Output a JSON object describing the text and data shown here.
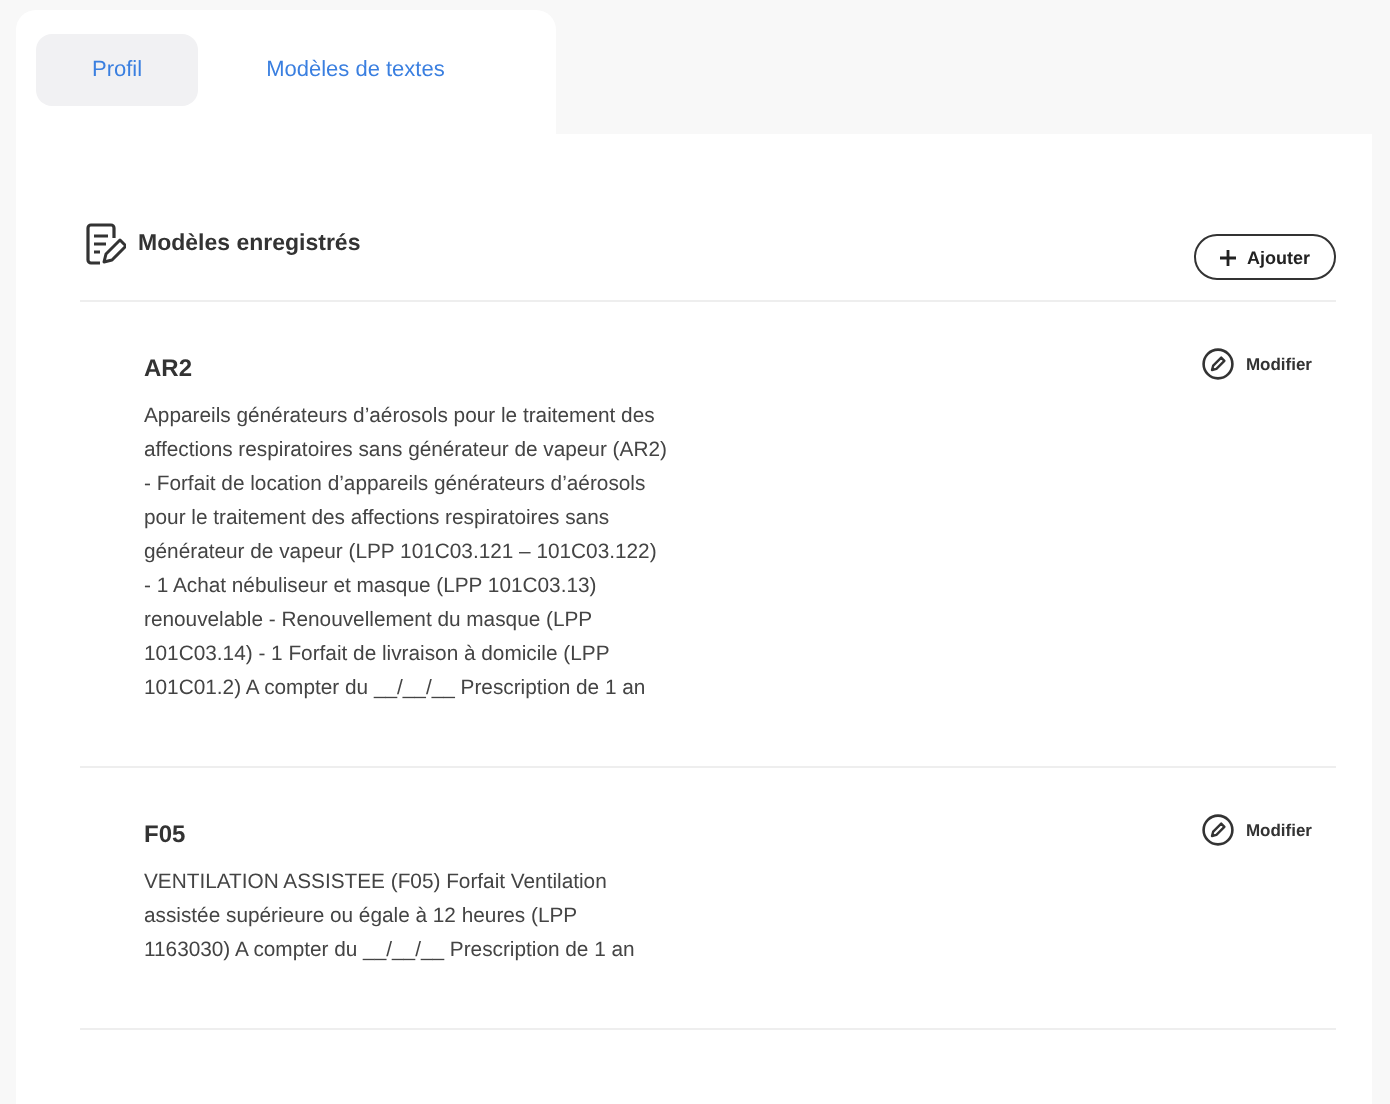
{
  "tabs": [
    {
      "label": "Profil",
      "selected": true
    },
    {
      "label": "Modèles de textes",
      "selected": false
    }
  ],
  "section": {
    "title": "Modèles enregistrés",
    "add_button": "Ajouter"
  },
  "templates": [
    {
      "code": "AR2",
      "text": "Appareils générateurs d’aérosols pour le traitement des affections respiratoires sans générateur de vapeur (AR2) - Forfait de location d’appareils générateurs d’aérosols pour le traitement des affections respiratoires sans générateur de vapeur (LPP 101C03.121 – 101C03.122) - 1 Achat nébuliseur et masque (LPP 101C03.13) renouvelable - Renouvellement du masque (LPP 101C03.14) - 1 Forfait de livraison à domicile (LPP 101C01.2) A compter du __/__/__ Prescription de 1 an",
      "edit": "Modifier"
    },
    {
      "code": "F05",
      "text": "VENTILATION ASSISTEE (F05) Forfait Ventilation assistée supérieure ou égale à 12 heures (LPP 1163030) A compter du __/__/__ Prescription de 1 an",
      "edit": "Modifier"
    }
  ]
}
